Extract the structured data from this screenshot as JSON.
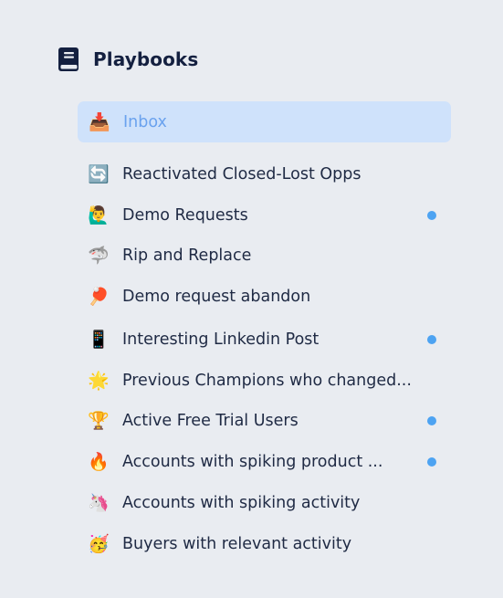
{
  "header": {
    "title": "Playbooks",
    "icon": "book-icon"
  },
  "inbox": {
    "label": "Inbox",
    "emoji": "📥",
    "selected": true
  },
  "playbooks": [
    {
      "emoji": "🔄",
      "label": "Reactivated Closed-Lost Opps",
      "unread": false
    },
    {
      "emoji": "🙋‍♂️",
      "label": "Demo Requests",
      "unread": true
    },
    {
      "emoji": "🦈",
      "label": "Rip and Replace",
      "unread": false
    },
    {
      "emoji": "🏓",
      "label": "Demo request abandon",
      "unread": false
    },
    {
      "emoji": "📱",
      "label": "Interesting Linkedin Post",
      "unread": true
    },
    {
      "emoji": "🌟",
      "label": "Previous Champions who changed...",
      "unread": false
    },
    {
      "emoji": "🏆",
      "label": "Active Free Trial Users",
      "unread": true
    },
    {
      "emoji": "🔥",
      "label": "Accounts with spiking product ...",
      "unread": true
    },
    {
      "emoji": "🦄",
      "label": "Accounts with spiking activity",
      "unread": false
    },
    {
      "emoji": "🥳",
      "label": "Buyers with relevant activity",
      "unread": false
    }
  ],
  "colors": {
    "background": "#e9ecf1",
    "selected_bg": "#cfe2fb",
    "selected_text": "#6aa2ee",
    "unread_dot": "#4da3f2",
    "text": "#1f2a44"
  }
}
